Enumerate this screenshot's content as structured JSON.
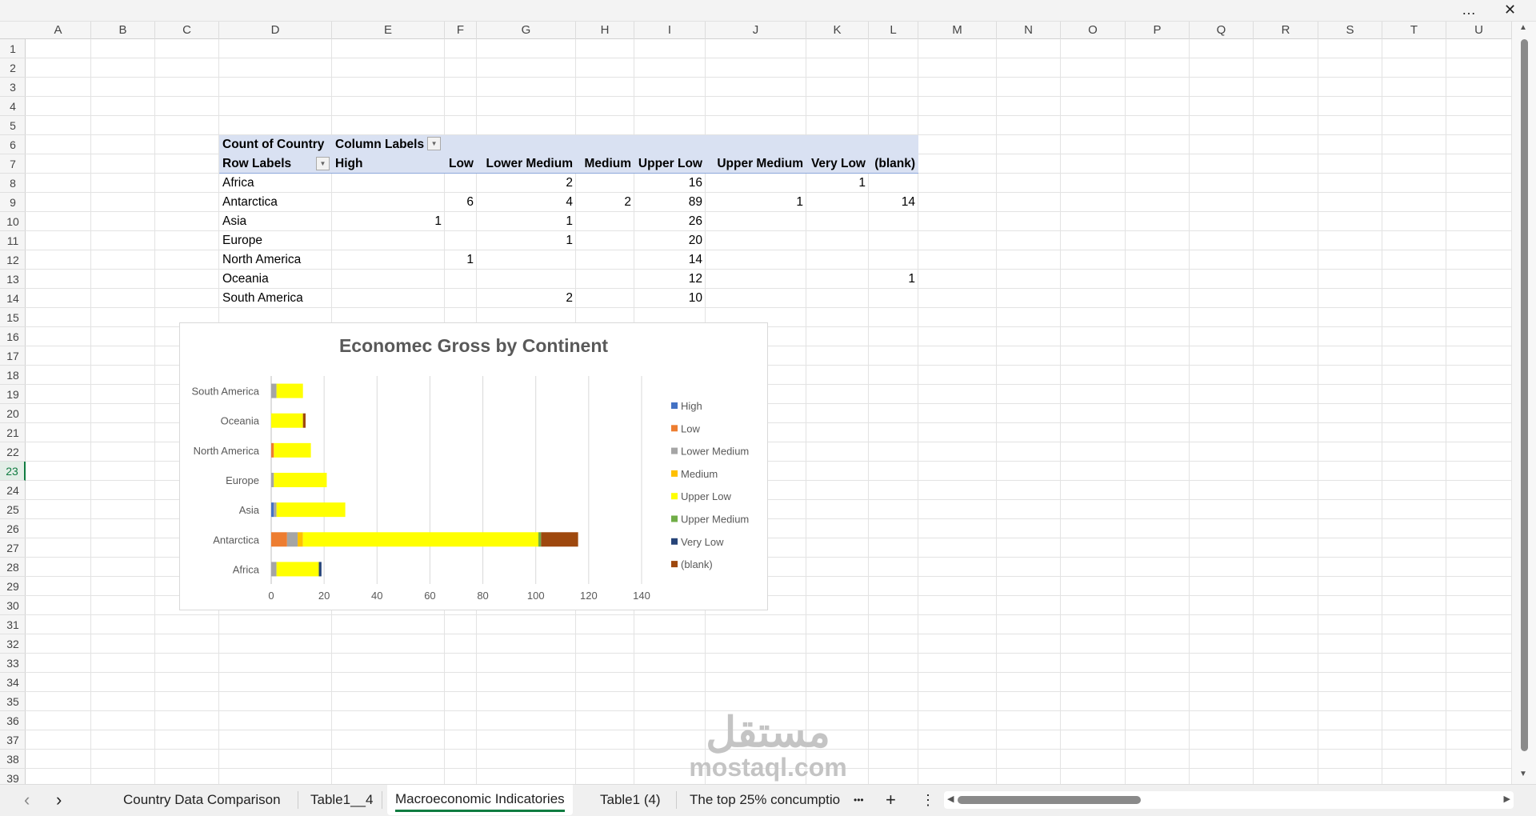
{
  "window": {
    "more_icon": "…",
    "close_icon": "✕"
  },
  "columns": [
    "A",
    "B",
    "C",
    "D",
    "E",
    "F",
    "G",
    "H",
    "I",
    "J",
    "K",
    "L",
    "M",
    "N",
    "O",
    "P",
    "Q",
    "R",
    "S",
    "T",
    "U"
  ],
  "row_numbers": [
    "1",
    "2",
    "3",
    "4",
    "5",
    "6",
    "7",
    "8",
    "9",
    "10",
    "11",
    "12",
    "13",
    "14",
    "15",
    "16",
    "17",
    "18",
    "19",
    "20",
    "21",
    "22",
    "23",
    "24",
    "25",
    "26",
    "27",
    "28",
    "29",
    "30",
    "31",
    "32",
    "33",
    "34",
    "35",
    "36",
    "37",
    "38",
    "39"
  ],
  "selected_row": "23",
  "pivot": {
    "value_label": "Count of Country",
    "column_labels": "Column Labels",
    "row_labels": "Row Labels",
    "headers": [
      "High",
      "Low",
      "Lower Medium",
      "Medium",
      "Upper Low",
      "Upper Medium",
      "Very Low",
      "(blank)"
    ],
    "rows": [
      {
        "label": "Africa",
        "values": [
          "",
          "",
          "2",
          "",
          "16",
          "",
          "1",
          ""
        ]
      },
      {
        "label": "Antarctica",
        "values": [
          "",
          "6",
          "4",
          "2",
          "89",
          "1",
          "",
          "14"
        ]
      },
      {
        "label": "Asia",
        "values": [
          "1",
          "",
          "1",
          "",
          "26",
          "",
          "",
          ""
        ]
      },
      {
        "label": "Europe",
        "values": [
          "",
          "",
          "1",
          "",
          "20",
          "",
          "",
          ""
        ]
      },
      {
        "label": "North America",
        "values": [
          "",
          "1",
          "",
          "",
          "14",
          "",
          "",
          ""
        ]
      },
      {
        "label": "Oceania",
        "values": [
          "",
          "",
          "",
          "",
          "12",
          "",
          "",
          "1"
        ]
      },
      {
        "label": "South America",
        "values": [
          "",
          "",
          "2",
          "",
          "10",
          "",
          "",
          ""
        ]
      }
    ]
  },
  "chart_data": {
    "type": "bar",
    "orientation": "horizontal-stacked",
    "title": "Economec Gross by Continent",
    "categories": [
      "Africa",
      "Antarctica",
      "Asia",
      "Europe",
      "North America",
      "Oceania",
      "South America"
    ],
    "series": [
      {
        "name": "High",
        "color": "#4472C4",
        "values": [
          0,
          0,
          1,
          0,
          0,
          0,
          0
        ]
      },
      {
        "name": "Low",
        "color": "#ED7D31",
        "values": [
          0,
          6,
          0,
          0,
          1,
          0,
          0
        ]
      },
      {
        "name": "Lower Medium",
        "color": "#A5A5A5",
        "values": [
          2,
          4,
          1,
          1,
          0,
          0,
          2
        ]
      },
      {
        "name": "Medium",
        "color": "#FFC000",
        "values": [
          0,
          2,
          0,
          0,
          0,
          0,
          0
        ]
      },
      {
        "name": "Upper Low",
        "color": "#FFFF00",
        "values": [
          16,
          89,
          26,
          20,
          14,
          12,
          10
        ]
      },
      {
        "name": "Upper Medium",
        "color": "#70AD47",
        "values": [
          0,
          1,
          0,
          0,
          0,
          0,
          0
        ]
      },
      {
        "name": "Very Low",
        "color": "#264478",
        "values": [
          1,
          0,
          0,
          0,
          0,
          0,
          0
        ]
      },
      {
        "name": "(blank)",
        "color": "#9E480E",
        "values": [
          0,
          14,
          0,
          0,
          0,
          1,
          0
        ]
      }
    ],
    "xlim": [
      0,
      140
    ],
    "xticks": [
      "0",
      "20",
      "40",
      "60",
      "80",
      "100",
      "120",
      "140"
    ],
    "grid": true,
    "legend": "right"
  },
  "sheet_tabs": [
    "Country Data Comparison",
    "Table1__4",
    "Macroeconomic Indicatories",
    "Table1 (4)",
    "The top 25% concumptio"
  ],
  "active_tab": "Macroeconomic Indicatories",
  "tab_nav": {
    "prev": "‹",
    "next": "›",
    "more": "•••",
    "add": "+",
    "options": "⋮"
  },
  "watermark": {
    "arabic": "مستقل",
    "latin": "mostaql.com"
  }
}
